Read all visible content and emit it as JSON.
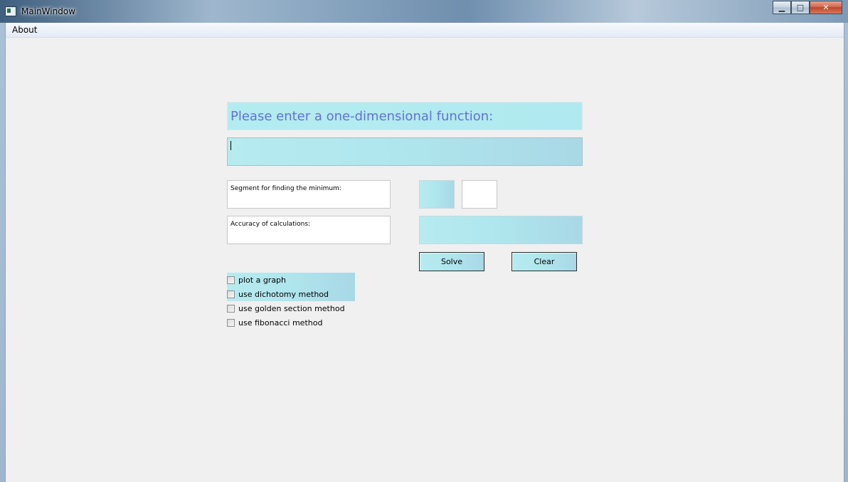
{
  "window": {
    "title": "MainWindow",
    "controls": {
      "minimize": "▁",
      "maximize": "□",
      "close": "✕"
    }
  },
  "menubar": {
    "items": [
      "About"
    ]
  },
  "form": {
    "heading": "Please enter a one-dimensional function:",
    "function_value": "",
    "segment_label": "Segment for finding the minimum:",
    "segment_from": "",
    "segment_to": "",
    "accuracy_label": "Accuracy of calculations:",
    "accuracy_value": "",
    "solve_label": "Solve",
    "clear_label": "Clear",
    "checkboxes": [
      {
        "label": "plot a graph",
        "checked": false
      },
      {
        "label": "use dichotomy method",
        "checked": false
      },
      {
        "label": "use golden section method",
        "checked": false
      },
      {
        "label": "use fibonacci method",
        "checked": false
      }
    ]
  },
  "colors": {
    "accent_cyan": "#b3ecf0",
    "heading_text": "#6470d6",
    "client_bg": "#f0f0f0"
  }
}
